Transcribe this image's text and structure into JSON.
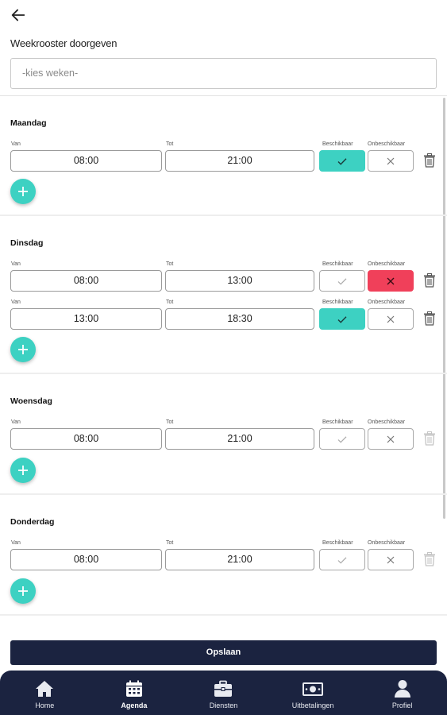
{
  "header": {
    "title": "Weekrooster doorgeven"
  },
  "week_select": {
    "placeholder": "-kies weken-"
  },
  "columns": {
    "van": "Van",
    "tot": "Tot",
    "beschikbaar": "Beschikbaar",
    "onbeschikbaar": "Onbeschikbaar"
  },
  "days": [
    {
      "name": "Maandag",
      "slots": [
        {
          "van": "08:00",
          "tot": "21:00",
          "status": "beschikbaar"
        }
      ]
    },
    {
      "name": "Dinsdag",
      "slots": [
        {
          "van": "08:00",
          "tot": "13:00",
          "status": "onbeschikbaar"
        },
        {
          "van": "13:00",
          "tot": "18:30",
          "status": "beschikbaar"
        }
      ]
    },
    {
      "name": "Woensdag",
      "slots": [
        {
          "van": "08:00",
          "tot": "21:00",
          "status": "none"
        }
      ]
    },
    {
      "name": "Donderdag",
      "slots": [
        {
          "van": "08:00",
          "tot": "21:00",
          "status": "none"
        }
      ]
    }
  ],
  "save_button": {
    "label": "Opslaan"
  },
  "nav": {
    "items": [
      {
        "label": "Home",
        "icon": "home-icon"
      },
      {
        "label": "Agenda",
        "icon": "calendar-icon",
        "active": true
      },
      {
        "label": "Diensten",
        "icon": "briefcase-icon"
      },
      {
        "label": "Uitbetalingen",
        "icon": "money-icon"
      },
      {
        "label": "Profiel",
        "icon": "user-icon"
      }
    ]
  },
  "colors": {
    "accent": "#3dd1c2",
    "danger": "#f0405a",
    "navy": "#1b2340"
  }
}
